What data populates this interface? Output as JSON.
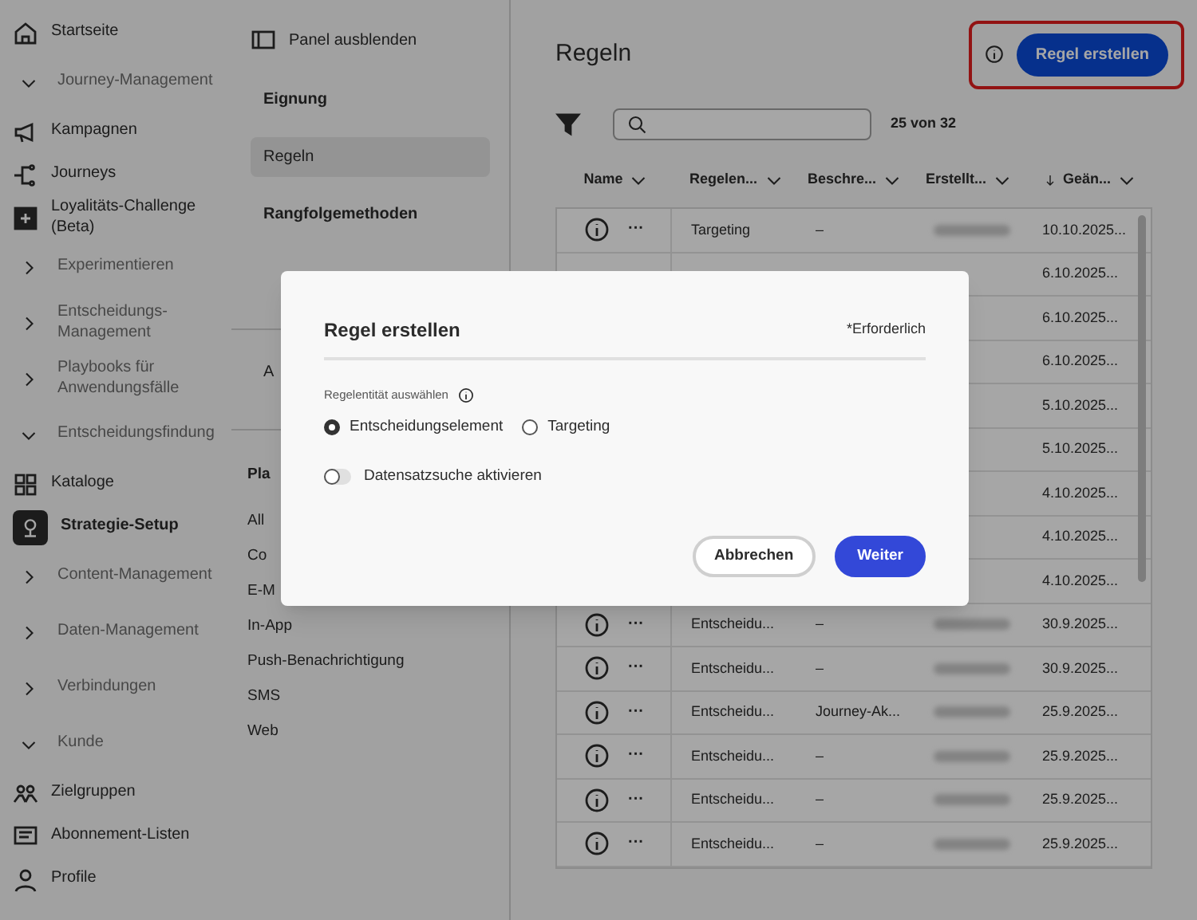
{
  "sidebar": {
    "items": [
      {
        "kind": "link",
        "label": "Startseite",
        "selected": false
      },
      {
        "kind": "section",
        "label": "Journey-Management",
        "expanded": true
      },
      {
        "kind": "link",
        "label": "Kampagnen",
        "selected": false
      },
      {
        "kind": "link",
        "label": "Journeys",
        "selected": false
      },
      {
        "kind": "link",
        "label": "Loyalitäts-Challenge (Beta)",
        "selected": false
      },
      {
        "kind": "section",
        "label": "Experimentieren",
        "expanded": false
      },
      {
        "kind": "section",
        "label": "Entscheidungs-Management",
        "expanded": false
      },
      {
        "kind": "section",
        "label": "Playbooks für Anwendungsfälle",
        "expanded": false
      },
      {
        "kind": "section",
        "label": "Entscheidungsfindung",
        "expanded": true
      },
      {
        "kind": "link",
        "label": "Kataloge",
        "selected": false
      },
      {
        "kind": "link",
        "label": "Strategie-Setup",
        "selected": true
      },
      {
        "kind": "section",
        "label": "Content-Management",
        "expanded": false
      },
      {
        "kind": "section",
        "label": "Daten-Management",
        "expanded": false
      },
      {
        "kind": "section",
        "label": "Verbindungen",
        "expanded": false
      },
      {
        "kind": "section",
        "label": "Kunde",
        "expanded": true
      },
      {
        "kind": "link",
        "label": "Zielgruppen",
        "selected": false
      },
      {
        "kind": "link",
        "label": "Abonnement-Listen",
        "selected": false
      },
      {
        "kind": "link",
        "label": "Profile",
        "selected": false
      }
    ]
  },
  "panel": {
    "hide_label": "Panel ausblenden",
    "items": [
      {
        "kind": "heading",
        "label": "Eignung"
      },
      {
        "kind": "item",
        "label": "Regeln",
        "selected": true
      },
      {
        "kind": "heading",
        "label": "Rangfolgemethoden"
      },
      {
        "kind": "divider"
      },
      {
        "kind": "item",
        "label": "A",
        "selected": false
      },
      {
        "kind": "divider"
      },
      {
        "kind": "channel_heading",
        "label": "Pla"
      },
      {
        "kind": "channel",
        "label": "All"
      },
      {
        "kind": "channel",
        "label": "Co"
      },
      {
        "kind": "channel",
        "label": "E-M"
      },
      {
        "kind": "channel",
        "label": "In-App"
      },
      {
        "kind": "channel",
        "label": "Push-Benachrichtigung"
      },
      {
        "kind": "channel",
        "label": "SMS"
      },
      {
        "kind": "channel",
        "label": "Web"
      }
    ]
  },
  "main": {
    "title": "Regeln",
    "create_button": "Regel erstellen",
    "count": "25 von 32",
    "columns": [
      {
        "label": "Name",
        "sorted": false
      },
      {
        "label": "Regelen...",
        "sorted": false
      },
      {
        "label": "Beschre...",
        "sorted": false
      },
      {
        "label": "Erstellt...",
        "sorted": false
      },
      {
        "label": "Geän...",
        "sorted": true
      }
    ],
    "rows": [
      {
        "more": "···",
        "type": "Targeting",
        "description": "–",
        "creator_blurred": true,
        "date": "10.10.2025..."
      },
      {
        "date": "6.10.2025..."
      },
      {
        "date": "6.10.2025..."
      },
      {
        "date": "6.10.2025..."
      },
      {
        "date": "5.10.2025..."
      },
      {
        "date": "5.10.2025..."
      },
      {
        "date": "4.10.2025..."
      },
      {
        "date": "4.10.2025..."
      },
      {
        "date": "4.10.2025..."
      },
      {
        "more": "···",
        "type": "Entscheidu...",
        "description": "–",
        "creator_blurred": true,
        "date": "30.9.2025..."
      },
      {
        "more": "···",
        "type": "Entscheidu...",
        "description": "–",
        "creator_blurred": true,
        "date": "30.9.2025..."
      },
      {
        "more": "···",
        "type": "Entscheidu...",
        "description": "Journey-Ak...",
        "creator_blurred": true,
        "date": "25.9.2025..."
      },
      {
        "more": "···",
        "type": "Entscheidu...",
        "description": "–",
        "creator_blurred": true,
        "date": "25.9.2025..."
      },
      {
        "more": "···",
        "type": "Entscheidu...",
        "description": "–",
        "creator_blurred": true,
        "date": "25.9.2025..."
      },
      {
        "more": "···",
        "type": "Entscheidu...",
        "description": "–",
        "creator_blurred": true,
        "date": "25.9.2025..."
      }
    ]
  },
  "dialog": {
    "title": "Regel erstellen",
    "required_note": "*Erforderlich",
    "field_label": "Regelentität auswählen",
    "options": [
      {
        "label": "Entscheidungselement",
        "selected": true
      },
      {
        "label": "Targeting",
        "selected": false
      }
    ],
    "toggle": {
      "label": "Datensatzsuche aktivieren",
      "on": false
    },
    "buttons": [
      {
        "kind": "secondary",
        "label": "Abbrechen"
      },
      {
        "kind": "primary",
        "label": "Weiter"
      }
    ]
  }
}
